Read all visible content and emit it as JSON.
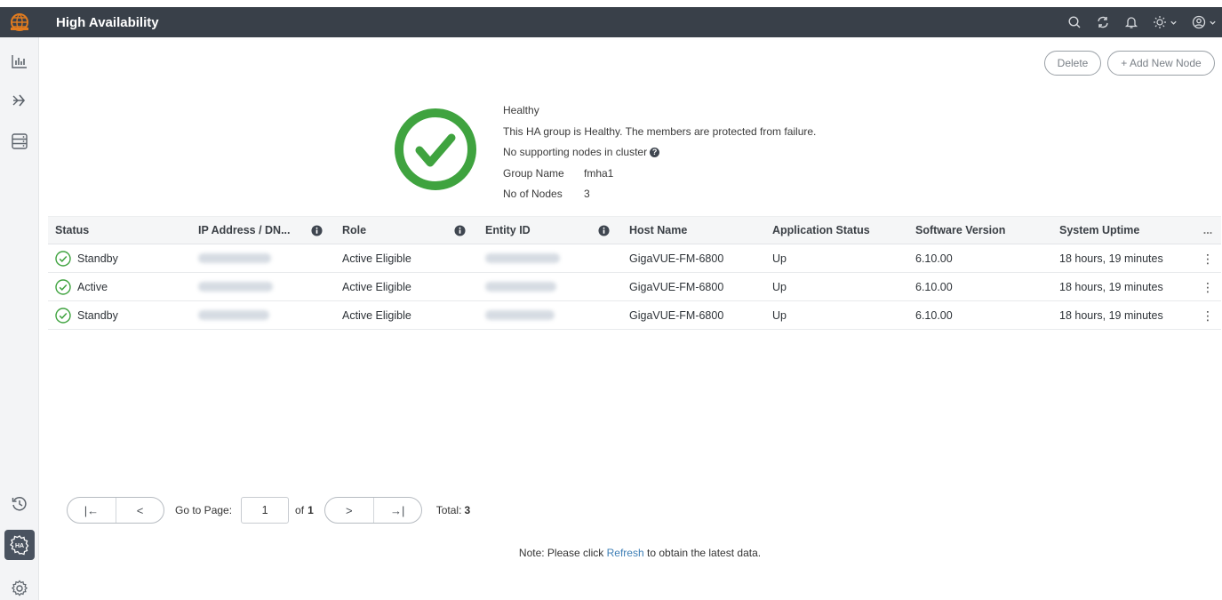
{
  "app": {
    "title": "High Availability"
  },
  "toolbar": {
    "delete_label": "Delete",
    "add_label": "+ Add New Node"
  },
  "summary": {
    "status": "Healthy",
    "message": "This HA group is Healthy. The members are protected from failure.",
    "supporting": "No supporting nodes in cluster",
    "group_name_label": "Group Name",
    "group_name_value": "fmha1",
    "nodes_label": "No of Nodes",
    "nodes_value": "3"
  },
  "table": {
    "columns": [
      "Status",
      "IP Address / DN...",
      "Role",
      "Entity ID",
      "Host Name",
      "Application Status",
      "Software Version",
      "System Uptime",
      "..."
    ],
    "rows": [
      {
        "status": "Standby",
        "role": "Active Eligible",
        "host": "GigaVUE-FM-6800",
        "app_status": "Up",
        "version": "6.10.00",
        "uptime": "18 hours, 19 minutes",
        "more": "⋮"
      },
      {
        "status": "Active",
        "role": "Active Eligible",
        "host": "GigaVUE-FM-6800",
        "app_status": "Up",
        "version": "6.10.00",
        "uptime": "18 hours, 19 minutes",
        "more": "⋮"
      },
      {
        "status": "Standby",
        "role": "Active Eligible",
        "host": "GigaVUE-FM-6800",
        "app_status": "Up",
        "version": "6.10.00",
        "uptime": "18 hours, 19 minutes",
        "more": "⋮"
      }
    ]
  },
  "pagination": {
    "first": "|←",
    "prev": "<",
    "next": ">",
    "last": "→|",
    "go_to_label": "Go to Page:",
    "page_value": "1",
    "of_label": "of",
    "total_pages": "1",
    "total_label": "Total:",
    "total_value": "3"
  },
  "note": {
    "prefix": "Note: Please click",
    "link": "Refresh",
    "suffix": "to obtain the latest data."
  },
  "colors": {
    "topbar": "#394049",
    "healthy_green": "#3fa33f",
    "link": "#3e7fb6",
    "logo_orange": "#e07b1f"
  },
  "icons": {
    "topbar": [
      "search-icon",
      "refresh-icon",
      "bell-icon",
      "theme-icon",
      "user-icon"
    ],
    "sidebar": [
      "dashboard-icon",
      "traffic-icon",
      "inventory-icon",
      "history-icon",
      "high-availability-icon",
      "settings-icon"
    ]
  }
}
